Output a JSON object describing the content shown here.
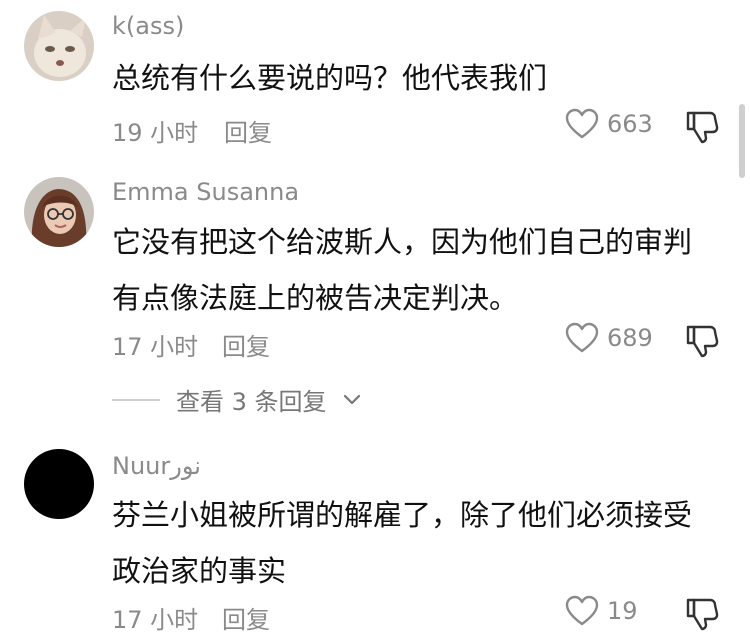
{
  "comments": [
    {
      "username": "k(ass)",
      "lines": [
        "总统有什么要说的吗？他代表我们"
      ],
      "time": "19 小时",
      "reply_label": "回复",
      "likes": "663"
    },
    {
      "username": "Emma Susanna",
      "lines": [
        "它没有把这个给波斯人，因为他们自己的审判",
        "有点像法庭上的被告决定判决。"
      ],
      "time": "17 小时",
      "reply_label": "回复",
      "likes": "689"
    },
    {
      "username": "Nuurنور",
      "lines": [
        "芬兰小姐被所谓的解雇了，除了他们必须接受",
        "政治家的事实"
      ],
      "time": "17 小时",
      "reply_label": "回复",
      "likes": "19"
    }
  ],
  "view_replies": "查看 3 条回复",
  "colors": {
    "text": "#111111",
    "muted": "#8a8a8a",
    "background": "#ffffff"
  },
  "icons": [
    "heart-icon",
    "thumbs-down-icon",
    "chevron-down-icon"
  ]
}
